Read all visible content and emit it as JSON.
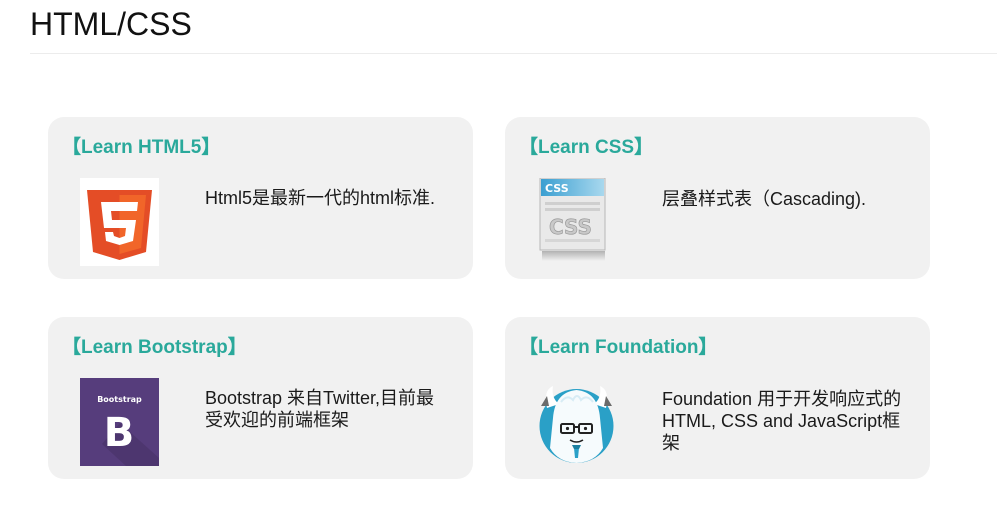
{
  "page": {
    "title": "HTML/CSS"
  },
  "cards": [
    {
      "title": "【Learn HTML5】",
      "description": "Html5是最新一代的html标准.",
      "icon": "html5-logo-icon"
    },
    {
      "title": "【Learn CSS】",
      "description": "层叠样式表（Cascading).",
      "icon": "css-file-icon"
    },
    {
      "title": "【Learn Bootstrap】",
      "description": "Bootstrap 来自Twitter,目前最受欢迎的前端框架",
      "icon": "bootstrap-logo-icon",
      "icon_label": "Bootstrap"
    },
    {
      "title": "【Learn Foundation】",
      "description": "Foundation 用于开发响应式的 HTML, CSS and JavaScript框架",
      "icon": "foundation-yeti-icon"
    }
  ],
  "colors": {
    "accent": "#2aa99b",
    "card_background": "#f1f1f1",
    "html5_orange": "#e44d26",
    "bootstrap_purple": "#563d7c",
    "foundation_blue": "#2aa0c7"
  }
}
